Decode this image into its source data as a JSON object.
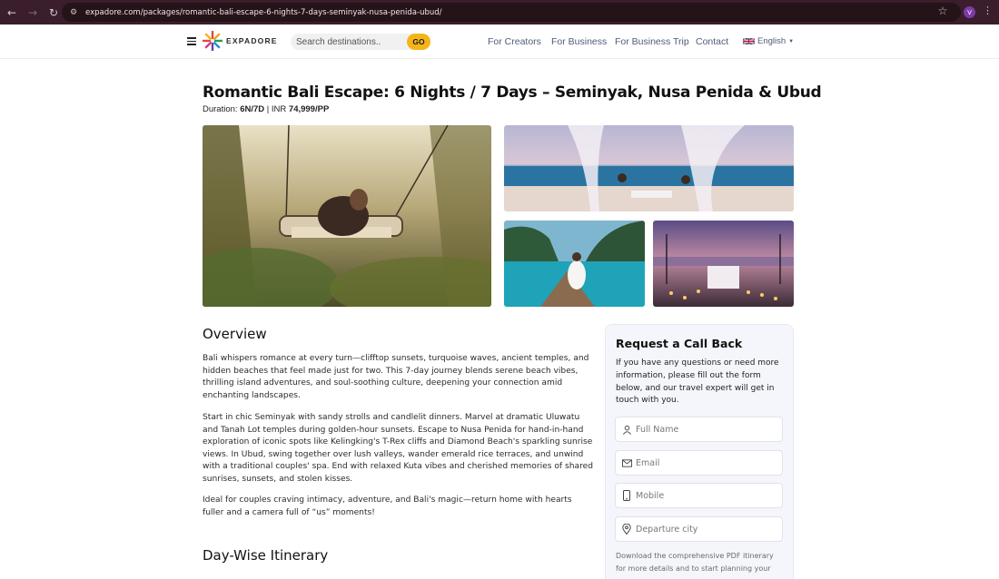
{
  "browser": {
    "url": "expadore.com/packages/romantic-bali-escape-6-nights-7-days-seminyak-nusa-penida-ubud/",
    "profile_initial": "V"
  },
  "header": {
    "logo_text": "EXPADORE",
    "search_placeholder": "Search destinations..",
    "go_label": "GO",
    "nav": [
      "For Creators",
      "For Business",
      "For Business Trip",
      "Contact"
    ],
    "language": "English"
  },
  "package": {
    "title": "Romantic Bali Escape: 6 Nights / 7 Days – Seminyak, Nusa Penida & Ubud",
    "duration_label": "Duration:",
    "duration_value": "6N/7D",
    "separator": "|",
    "price_currency": "INR",
    "price_value": "74,999/PP"
  },
  "gallery": {
    "photos": [
      "jungle-swing-couple",
      "beach-dinner-canopy",
      "boat-lagoon-woman",
      "candlelit-beach-dinner"
    ]
  },
  "overview": {
    "heading": "Overview",
    "paragraphs": [
      "Bali whispers romance at every turn—clifftop sunsets, turquoise waves, ancient temples, and hidden beaches that feel made just for two. This 7-day journey blends serene beach vibes, thrilling island adventures, and soul-soothing culture, deepening your connection amid enchanting landscapes.",
      "Start in chic Seminyak with sandy strolls and candlelit dinners. Marvel at dramatic Uluwatu and Tanah Lot temples during golden-hour sunsets. Escape to Nusa Penida for hand-in-hand exploration of iconic spots like Kelingking's T-Rex cliffs and Diamond Beach's sparkling sunrise views. In Ubud, swing together over lush valleys, wander emerald rice terraces, and unwind with a traditional couples' spa. End with relaxed Kuta vibes and cherished memories of shared sunrises, sunsets, and stolen kisses.",
      "Ideal for couples craving intimacy, adventure, and Bali's magic—return home with hearts fuller and a camera full of “us” moments!"
    ]
  },
  "itinerary": {
    "heading": "Day-Wise Itinerary"
  },
  "callback": {
    "title": "Request a Call Back",
    "description": "If you have any questions or need more information, please fill out the form below, and our travel expert will get in touch with you.",
    "fields": {
      "name_placeholder": "Full Name",
      "email_placeholder": "Email",
      "mobile_placeholder": "Mobile",
      "city_placeholder": "Departure city"
    },
    "note": "Download the comprehensive PDF itinerary for more details and to start planning your"
  },
  "colors": {
    "chrome_bg": "#3a1e2c",
    "go_button": "#f3b519",
    "nav_text": "#4e5c7a",
    "card_bg": "#f5f6fb"
  }
}
